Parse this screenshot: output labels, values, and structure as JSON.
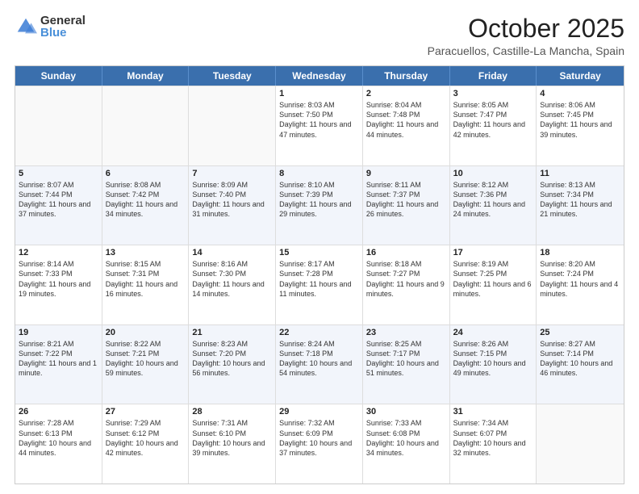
{
  "logo": {
    "general": "General",
    "blue": "Blue"
  },
  "header": {
    "month": "October 2025",
    "location": "Paracuellos, Castille-La Mancha, Spain"
  },
  "days": [
    "Sunday",
    "Monday",
    "Tuesday",
    "Wednesday",
    "Thursday",
    "Friday",
    "Saturday"
  ],
  "rows": [
    [
      {
        "day": "",
        "text": ""
      },
      {
        "day": "",
        "text": ""
      },
      {
        "day": "",
        "text": ""
      },
      {
        "day": "1",
        "text": "Sunrise: 8:03 AM\nSunset: 7:50 PM\nDaylight: 11 hours and 47 minutes."
      },
      {
        "day": "2",
        "text": "Sunrise: 8:04 AM\nSunset: 7:48 PM\nDaylight: 11 hours and 44 minutes."
      },
      {
        "day": "3",
        "text": "Sunrise: 8:05 AM\nSunset: 7:47 PM\nDaylight: 11 hours and 42 minutes."
      },
      {
        "day": "4",
        "text": "Sunrise: 8:06 AM\nSunset: 7:45 PM\nDaylight: 11 hours and 39 minutes."
      }
    ],
    [
      {
        "day": "5",
        "text": "Sunrise: 8:07 AM\nSunset: 7:44 PM\nDaylight: 11 hours and 37 minutes."
      },
      {
        "day": "6",
        "text": "Sunrise: 8:08 AM\nSunset: 7:42 PM\nDaylight: 11 hours and 34 minutes."
      },
      {
        "day": "7",
        "text": "Sunrise: 8:09 AM\nSunset: 7:40 PM\nDaylight: 11 hours and 31 minutes."
      },
      {
        "day": "8",
        "text": "Sunrise: 8:10 AM\nSunset: 7:39 PM\nDaylight: 11 hours and 29 minutes."
      },
      {
        "day": "9",
        "text": "Sunrise: 8:11 AM\nSunset: 7:37 PM\nDaylight: 11 hours and 26 minutes."
      },
      {
        "day": "10",
        "text": "Sunrise: 8:12 AM\nSunset: 7:36 PM\nDaylight: 11 hours and 24 minutes."
      },
      {
        "day": "11",
        "text": "Sunrise: 8:13 AM\nSunset: 7:34 PM\nDaylight: 11 hours and 21 minutes."
      }
    ],
    [
      {
        "day": "12",
        "text": "Sunrise: 8:14 AM\nSunset: 7:33 PM\nDaylight: 11 hours and 19 minutes."
      },
      {
        "day": "13",
        "text": "Sunrise: 8:15 AM\nSunset: 7:31 PM\nDaylight: 11 hours and 16 minutes."
      },
      {
        "day": "14",
        "text": "Sunrise: 8:16 AM\nSunset: 7:30 PM\nDaylight: 11 hours and 14 minutes."
      },
      {
        "day": "15",
        "text": "Sunrise: 8:17 AM\nSunset: 7:28 PM\nDaylight: 11 hours and 11 minutes."
      },
      {
        "day": "16",
        "text": "Sunrise: 8:18 AM\nSunset: 7:27 PM\nDaylight: 11 hours and 9 minutes."
      },
      {
        "day": "17",
        "text": "Sunrise: 8:19 AM\nSunset: 7:25 PM\nDaylight: 11 hours and 6 minutes."
      },
      {
        "day": "18",
        "text": "Sunrise: 8:20 AM\nSunset: 7:24 PM\nDaylight: 11 hours and 4 minutes."
      }
    ],
    [
      {
        "day": "19",
        "text": "Sunrise: 8:21 AM\nSunset: 7:22 PM\nDaylight: 11 hours and 1 minute."
      },
      {
        "day": "20",
        "text": "Sunrise: 8:22 AM\nSunset: 7:21 PM\nDaylight: 10 hours and 59 minutes."
      },
      {
        "day": "21",
        "text": "Sunrise: 8:23 AM\nSunset: 7:20 PM\nDaylight: 10 hours and 56 minutes."
      },
      {
        "day": "22",
        "text": "Sunrise: 8:24 AM\nSunset: 7:18 PM\nDaylight: 10 hours and 54 minutes."
      },
      {
        "day": "23",
        "text": "Sunrise: 8:25 AM\nSunset: 7:17 PM\nDaylight: 10 hours and 51 minutes."
      },
      {
        "day": "24",
        "text": "Sunrise: 8:26 AM\nSunset: 7:15 PM\nDaylight: 10 hours and 49 minutes."
      },
      {
        "day": "25",
        "text": "Sunrise: 8:27 AM\nSunset: 7:14 PM\nDaylight: 10 hours and 46 minutes."
      }
    ],
    [
      {
        "day": "26",
        "text": "Sunrise: 7:28 AM\nSunset: 6:13 PM\nDaylight: 10 hours and 44 minutes."
      },
      {
        "day": "27",
        "text": "Sunrise: 7:29 AM\nSunset: 6:12 PM\nDaylight: 10 hours and 42 minutes."
      },
      {
        "day": "28",
        "text": "Sunrise: 7:31 AM\nSunset: 6:10 PM\nDaylight: 10 hours and 39 minutes."
      },
      {
        "day": "29",
        "text": "Sunrise: 7:32 AM\nSunset: 6:09 PM\nDaylight: 10 hours and 37 minutes."
      },
      {
        "day": "30",
        "text": "Sunrise: 7:33 AM\nSunset: 6:08 PM\nDaylight: 10 hours and 34 minutes."
      },
      {
        "day": "31",
        "text": "Sunrise: 7:34 AM\nSunset: 6:07 PM\nDaylight: 10 hours and 32 minutes."
      },
      {
        "day": "",
        "text": ""
      }
    ]
  ]
}
